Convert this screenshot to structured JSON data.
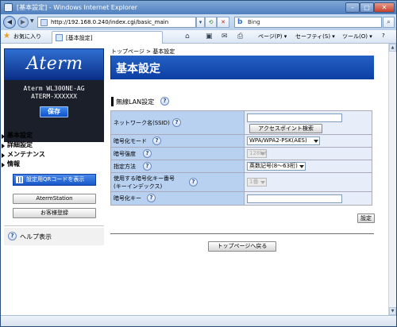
{
  "window": {
    "title": "[基本設定] - Windows Internet Explorer",
    "min_glyph": "–",
    "max_glyph": "□",
    "close_glyph": "✕"
  },
  "address_bar": {
    "url": "http://192.168.0.240/index.cgi/basic_main",
    "search_value": "Bing",
    "back_glyph": "◀",
    "forward_glyph": "▶",
    "go_glyph": "⌕"
  },
  "command_bar": {
    "favorites_label": "お気に入り",
    "tab_label": "[基本設定]",
    "page_menu": "ページ(P) ▾",
    "safety_menu": "セーフティ(S) ▾",
    "tools_menu": "ツール(O) ▾",
    "help_glyph": "?"
  },
  "sidebar": {
    "logo": "Aterm",
    "model": "Aterm WL300NE-AG",
    "device_name": "ATERM-XXXXXX",
    "save_button": "保存",
    "menu": [
      {
        "label": "基本設定"
      },
      {
        "label": "詳細設定"
      },
      {
        "label": "メンテナンス"
      },
      {
        "label": "情報"
      }
    ],
    "qr_button": "設定用QRコードを表示",
    "aterm_station_button": "AtermStation",
    "customer_button": "お客様登録",
    "help_label": "ヘルプ表示"
  },
  "main": {
    "breadcrumb_home": "トップページ",
    "breadcrumb_sep": ">",
    "breadcrumb_current": "基本設定",
    "page_title": "基本設定",
    "section_title": "無線LAN設定",
    "rows": [
      {
        "label": "ネットワーク名(SSID)",
        "value": ""
      },
      {
        "label": "暗号化モード",
        "value": "WPA/WPA2-PSK(AES)"
      },
      {
        "label": "暗号強度",
        "value": "128bit"
      },
      {
        "label": "指定方法",
        "value": "英数記号(8〜63桁)"
      },
      {
        "label": "使用する暗号化キー番号",
        "label2": "(キーインデックス)",
        "value": "1番"
      },
      {
        "label": "暗号化キー",
        "value": ""
      }
    ],
    "ap_search_button": "アクセスポイント検索",
    "set_button": "設定",
    "top_page_button": "トップページへ戻る"
  },
  "colors": {
    "title_blue": "#0d3fa3",
    "label_cell": "#b9d1f1",
    "value_cell": "#e7eef9",
    "logo_blue": "#1f5cc4"
  }
}
